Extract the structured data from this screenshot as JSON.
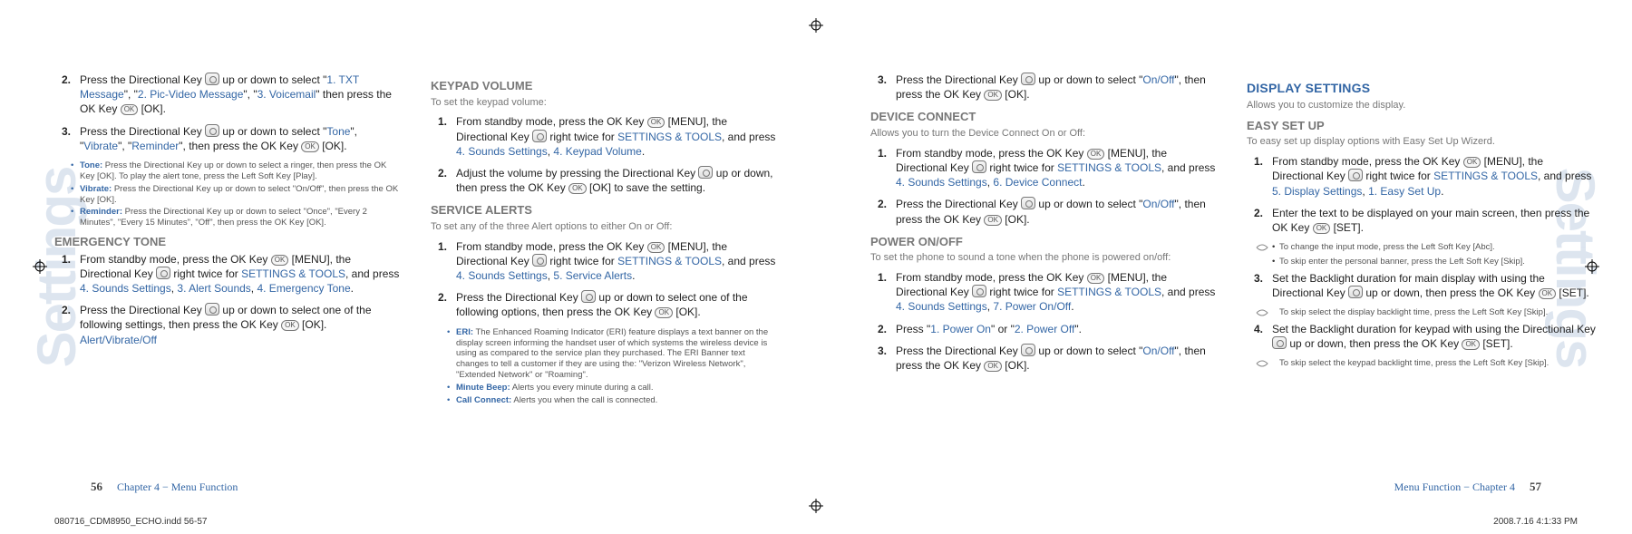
{
  "watermark": "Settings",
  "left_page": {
    "col1": {
      "items": [
        {
          "num": "2.",
          "pre": "Press the Directional Key ",
          "mid": " up or down to select \"",
          "opt1": "1. TXT Message",
          "sep": "\", \"",
          "opt2": "2. Pic-Video Message",
          "opt3": "3. Voicemail",
          "post": "\" then press the OK Key ",
          "tail": " [OK]."
        },
        {
          "num": "3.",
          "pre": "Press the Directional Key ",
          "mid": " up or down to select \"",
          "opt1": "Tone",
          "opt2": "Vibrate",
          "opt3": "Reminder",
          "post": "\", then press the OK Key ",
          "tail": " [OK]."
        }
      ],
      "subs": [
        {
          "lbl": "Tone:",
          "txt": "Press the Directional Key  up or down to select a ringer, then press the OK Key  [OK]. To play the alert tone, press the Left Soft Key  [Play]."
        },
        {
          "lbl": "Vibrate:",
          "txt": "Press the Directional Key  up or down to select \"On/Off\", then press the OK Key  [OK]."
        },
        {
          "lbl": "Reminder:",
          "txt": "Press the Directional Key  up or down to select \"Once\", \"Every 2 Minutes\", \"Every 15 Minutes\", \"Off\", then press the OK Key  [OK]."
        }
      ],
      "emergency_h": "EMERGENCY TONE",
      "emergency_items": [
        {
          "num": "1.",
          "pre": "From standby mode, press the OK Key ",
          "mid": " [MENU], the Directional Key ",
          "mid2": " right twice for ",
          "link": "SETTINGS & TOOLS",
          "post": ", and press ",
          "opt": "4. Sounds Settings",
          "sep2": ", ",
          "opt2": "3. Alert Sounds",
          "opt3": "4. Emergency Tone",
          "tail": "."
        },
        {
          "num": "2.",
          "pre": "Press the Directional Key ",
          "mid": " up or down to select one of the following settings, then press the OK Key ",
          "tail": " [OK].",
          "opts": "Alert/Vibrate/Off"
        }
      ]
    },
    "col2": {
      "kv_h": "KEYPAD VOLUME",
      "kv_sub": "To set the keypad volume:",
      "kv_items": [
        {
          "num": "1.",
          "pre": "From standby mode, press the OK Key ",
          "mid": " [MENU], the Directional Key ",
          "mid2": " right twice for ",
          "link": "SETTINGS & TOOLS",
          "post": ", and press ",
          "opt": "4. Sounds Settings",
          "opt2": "4. Keypad Volume",
          "tail": "."
        },
        {
          "num": "2.",
          "pre": "Adjust the volume by pressing the Directional Key ",
          "mid": " up or down, then press the OK Key ",
          "tail": " [OK] to save the setting."
        }
      ],
      "sa_h": "SERVICE ALERTS",
      "sa_sub": "To set any of the three Alert options to either On or Off:",
      "sa_items": [
        {
          "num": "1.",
          "pre": "From standby mode, press the OK Key ",
          "mid": " [MENU], the Directional Key ",
          "mid2": " right twice for ",
          "link": "SETTINGS & TOOLS",
          "post": ", and press ",
          "opt": "4. Sounds Settings",
          "opt2": "5. Service Alerts",
          "tail": "."
        },
        {
          "num": "2.",
          "pre": "Press the Directional Key ",
          "mid": " up or down to select one of the following options, then press the OK Key ",
          "tail": " [OK]."
        }
      ],
      "sa_subs": [
        {
          "lbl": "ERI:",
          "txt": "The Enhanced Roaming Indicator (ERI) feature displays a text banner on the display screen informing the handset user of which systems the wireless device is using as compared to the service plan they purchased. The ERI Banner text changes to tell a customer if they are using the: \"Verizon Wireless Network\", \"Extended Network\" or \"Roaming\"."
        },
        {
          "lbl": "Minute Beep:",
          "txt": "Alerts you every minute during a call."
        },
        {
          "lbl": "Call Connect:",
          "txt": "Alerts you when the call is connected."
        }
      ]
    },
    "footer": {
      "page": "56",
      "chapter": "Chapter 4 − Menu Function"
    }
  },
  "right_page": {
    "col1": {
      "top_item": {
        "num": "3.",
        "pre": "Press the Directional Key ",
        "mid": " up or down to select \"",
        "opt": "On/Off",
        "post": "\", then press the OK Key ",
        "tail": " [OK]."
      },
      "dc_h": "DEVICE CONNECT",
      "dc_sub": "Allows you to turn the Device Connect On or Off:",
      "dc_items": [
        {
          "num": "1.",
          "pre": "From standby mode, press the OK Key ",
          "mid": " [MENU], the Directional Key ",
          "mid2": " right twice for ",
          "link": "SETTINGS & TOOLS",
          "post": ", and press ",
          "opt": "4. Sounds Settings",
          "opt2": "6. Device Connect",
          "tail": "."
        },
        {
          "num": "2.",
          "pre": "Press the Directional Key ",
          "mid": " up or down to select \"",
          "opt": "On/Off",
          "post": "\", then press the OK Key ",
          "tail": " [OK]."
        }
      ],
      "po_h": "POWER ON/OFF",
      "po_sub": "To set the phone to sound a tone when the phone is powered on/off:",
      "po_items": [
        {
          "num": "1.",
          "pre": "From standby mode, press the OK Key ",
          "mid": " [MENU], the Directional Key ",
          "mid2": " right twice for ",
          "link": "SETTINGS & TOOLS",
          "post": ", and press ",
          "opt": "4. Sounds Settings",
          "opt2": "7. Power On/Off",
          "tail": "."
        },
        {
          "num": "2.",
          "pre": "Press \"",
          "opt": "1. Power On",
          "mid": "\" or \"",
          "opt2": "2. Power Off",
          "tail": "\"."
        },
        {
          "num": "3.",
          "pre": "Press the Directional Key ",
          "mid": " up or down to select \"",
          "opt": "On/Off",
          "post": "\", then press the OK Key ",
          "tail": " [OK]."
        }
      ]
    },
    "col2": {
      "ds_h": "DISPLAY SETTINGS",
      "ds_sub": "Allows you to customize the display.",
      "esu_h": "EASY SET UP",
      "esu_sub": "To easy set up display options with Easy Set Up Wizerd.",
      "esu_items": [
        {
          "num": "1.",
          "pre": "From standby mode, press the OK Key ",
          "mid": " [MENU], the Directional Key ",
          "mid2": " right twice for ",
          "link": "SETTINGS & TOOLS",
          "post": ", and press ",
          "opt": "5. Display Settings",
          "opt2": "1. Easy Set Up",
          "tail": "."
        },
        {
          "num": "2.",
          "pre": "Enter the text to be displayed on your main screen, then press the OK Key ",
          "tail": " [SET]."
        },
        {
          "num": "3.",
          "pre": "Set the Backlight duration for main display with using the Directional Key ",
          "mid": " up or down, then press the OK Key ",
          "tail": " [SET]."
        },
        {
          "num": "4.",
          "pre": "Set the Backlight duration for keypad with using the Directional Key ",
          "mid": " up or down, then press the OK Key ",
          "tail": " [SET]."
        }
      ],
      "tips": [
        "To change the input mode, press the Left Soft Key  [Abc].",
        "To skip enter the personal banner, press the Left Soft Key  [Skip].",
        "To skip select the display backlight time, press the Left Soft Key  [Skip].",
        "To skip select the keypad backlight time, press the Left Soft Key  [Skip]."
      ]
    },
    "footer": {
      "page": "57",
      "chapter": "Menu Function − Chapter 4"
    }
  },
  "imposition": {
    "file": "080716_CDM8950_ECHO.indd   56-57",
    "date": "2008.7.16   4:1:33 PM"
  }
}
